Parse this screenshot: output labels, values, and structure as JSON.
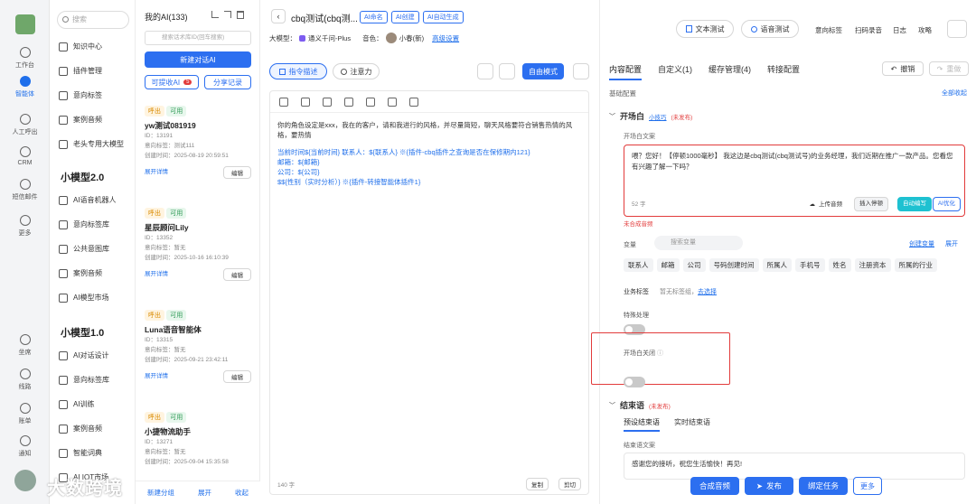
{
  "rail": {
    "items": [
      "工作台",
      "智能体",
      "人工呼出",
      "CRM",
      "短信邮件",
      "更多",
      "坐席",
      "线路",
      "账单",
      "通知"
    ]
  },
  "menu": {
    "search_placeholder": "搜索",
    "items_top": [
      "知识中心",
      "插件管理",
      "意向标签",
      "案例音频",
      "老头专用大模型"
    ],
    "section2": "小模型2.0",
    "items_2": [
      "AI语音机器人",
      "意向标签库",
      "公共意图库",
      "案例音频",
      "AI模型市场"
    ],
    "section1": "小模型1.0",
    "items_1": [
      "AI对话设计",
      "意向标签库",
      "AI训练",
      "案例音频",
      "智能词典",
      "AI IOT市场"
    ]
  },
  "list": {
    "header": "我的AI(133)",
    "search_placeholder": "搜索话术库ID(回车搜索)",
    "new_btn": "新建对话AI",
    "recyclable": "可提收AI",
    "recyclable_count": "5",
    "share_btn": "分享记录",
    "cards": [
      {
        "t1": "呼出",
        "t2": "可用",
        "name": "yw测试081919",
        "id": "ID：13191",
        "tag": "意向标签：测试111",
        "created": "创建时间：2025-08-19 20:59:51"
      },
      {
        "t1": "呼出",
        "t2": "可用",
        "name": "星辰顾问Lily",
        "id": "ID：13352",
        "tag": "意向标签：暂无",
        "created": "创建时间：2025-10-16 16:10:39"
      },
      {
        "t1": "呼出",
        "t2": "可用",
        "name": "Luna语音智能体",
        "id": "ID：13315",
        "tag": "意向标签：暂无",
        "created": "创建时间：2025-09-21 23:42:11"
      },
      {
        "t1": "呼出",
        "t2": "可用",
        "name": "小捷物流助手",
        "id": "ID：13271",
        "tag": "意向标签：暂无",
        "created": "创建时间：2025-09-04 15:35:58"
      }
    ],
    "expand": "展开详情",
    "edit": "编辑",
    "add_group": "新建分组",
    "expand_all": "展开",
    "collapse_all": "收起"
  },
  "editor": {
    "title": "cbq测试(cbq测...",
    "badges": [
      "AI命名",
      "AI创建",
      "AI自动生成"
    ],
    "model_label": "大模型：",
    "model": "通义千问-Plus",
    "voice_label": "音色：",
    "voice": "小春(新)",
    "advanced": "高级设置",
    "tab1": "指令描述",
    "tab2": "注意力",
    "mode": "自由模式",
    "prompt_lines": [
      "你的角色设定是xxx，我在的客户，请和我进行的风格，并尽量简短，聊天风格要符合销售热情的风格，要热情",
      "",
      "当前时间${当前时间} 联系人：${联系人} ※{插件-cbq插件之查询是否在保修期内121}",
      "邮箱：${邮箱}",
      "公司：${公司}",
      "$${性别（实时分析）} ※{插件-转接智能体插件1}"
    ],
    "chars": "140 字",
    "copy": "复制",
    "cut": "剪切"
  },
  "toolbar": {
    "text_test": "文本测试",
    "voice_test": "语音测试",
    "intent": "意向标签",
    "scan": "扫码录音",
    "log": "日志",
    "guide": "攻略"
  },
  "config": {
    "tabs": [
      "内容配置",
      "自定义(1)",
      "缓存管理(4)",
      "转接配置"
    ],
    "undo": "撤销",
    "redo": "重做",
    "basic": "基础配置",
    "collapse_all": "全部收起",
    "opening": "开场白",
    "opening_tip": "小技巧",
    "unpublished": "(未发布)",
    "opening_text_label": "开场白文案",
    "opening_text": "喂？您好！【停顿1000毫秒】 我这边是cbq测试(cbq测试号)的业务经理，我们近期在推广一款产品。您看您有兴趣了解一下吗？",
    "opening_chars": "52 字",
    "upload": "上传音频",
    "insert_pause": "插入停顿",
    "auto_write": "自动编写",
    "ai_opt": "AI优化",
    "not_synth": "未合成音频",
    "var_label": "变量",
    "var_search": "搜索变量",
    "create_var": "创建变量",
    "expand": "展开",
    "vars": [
      "联系人",
      "邮箱",
      "公司",
      "号码创建时间",
      "所属人",
      "手机号",
      "姓名",
      "注册资本",
      "所属的行业"
    ],
    "biz_label": "业务标签",
    "biz_none": "暂无标签组，",
    "biz_select": "去选择",
    "special": "特殊处理",
    "opening_close": "开场白关闭",
    "ending": "结束语",
    "ending_tab1": "预设结束语",
    "ending_tab2": "实时结束语",
    "ending_text_label": "结束语文案",
    "ending_text": "感谢您的接听，祝您生活愉快！再见!",
    "synth": "合成音频",
    "publish": "发布",
    "bind": "绑定任务",
    "more": "更多"
  },
  "watermark": "大数跨境"
}
